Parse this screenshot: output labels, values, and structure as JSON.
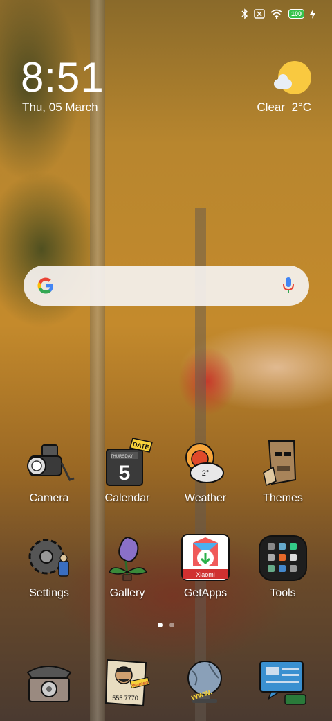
{
  "status_bar": {
    "battery": "100"
  },
  "clock": {
    "time": "8:51",
    "date": "Thu, 05 March"
  },
  "weather_widget": {
    "condition": "Clear",
    "temperature": "2°C"
  },
  "icons": {
    "calendar": {
      "banner": "DATE",
      "weekday": "THURSDAY",
      "day": "5"
    },
    "weather": {
      "temp": "2°"
    },
    "getapps": {
      "caption": "Xiaomi"
    },
    "phone_book": {
      "number": "555 7770",
      "tag": "Wanted"
    },
    "browser": {
      "text": "www."
    }
  },
  "apps": [
    {
      "label": "Camera"
    },
    {
      "label": "Calendar"
    },
    {
      "label": "Weather"
    },
    {
      "label": "Themes"
    },
    {
      "label": "Settings"
    },
    {
      "label": "Gallery"
    },
    {
      "label": "GetApps"
    },
    {
      "label": "Tools"
    }
  ],
  "pager": {
    "pages": 2,
    "current": 1
  }
}
